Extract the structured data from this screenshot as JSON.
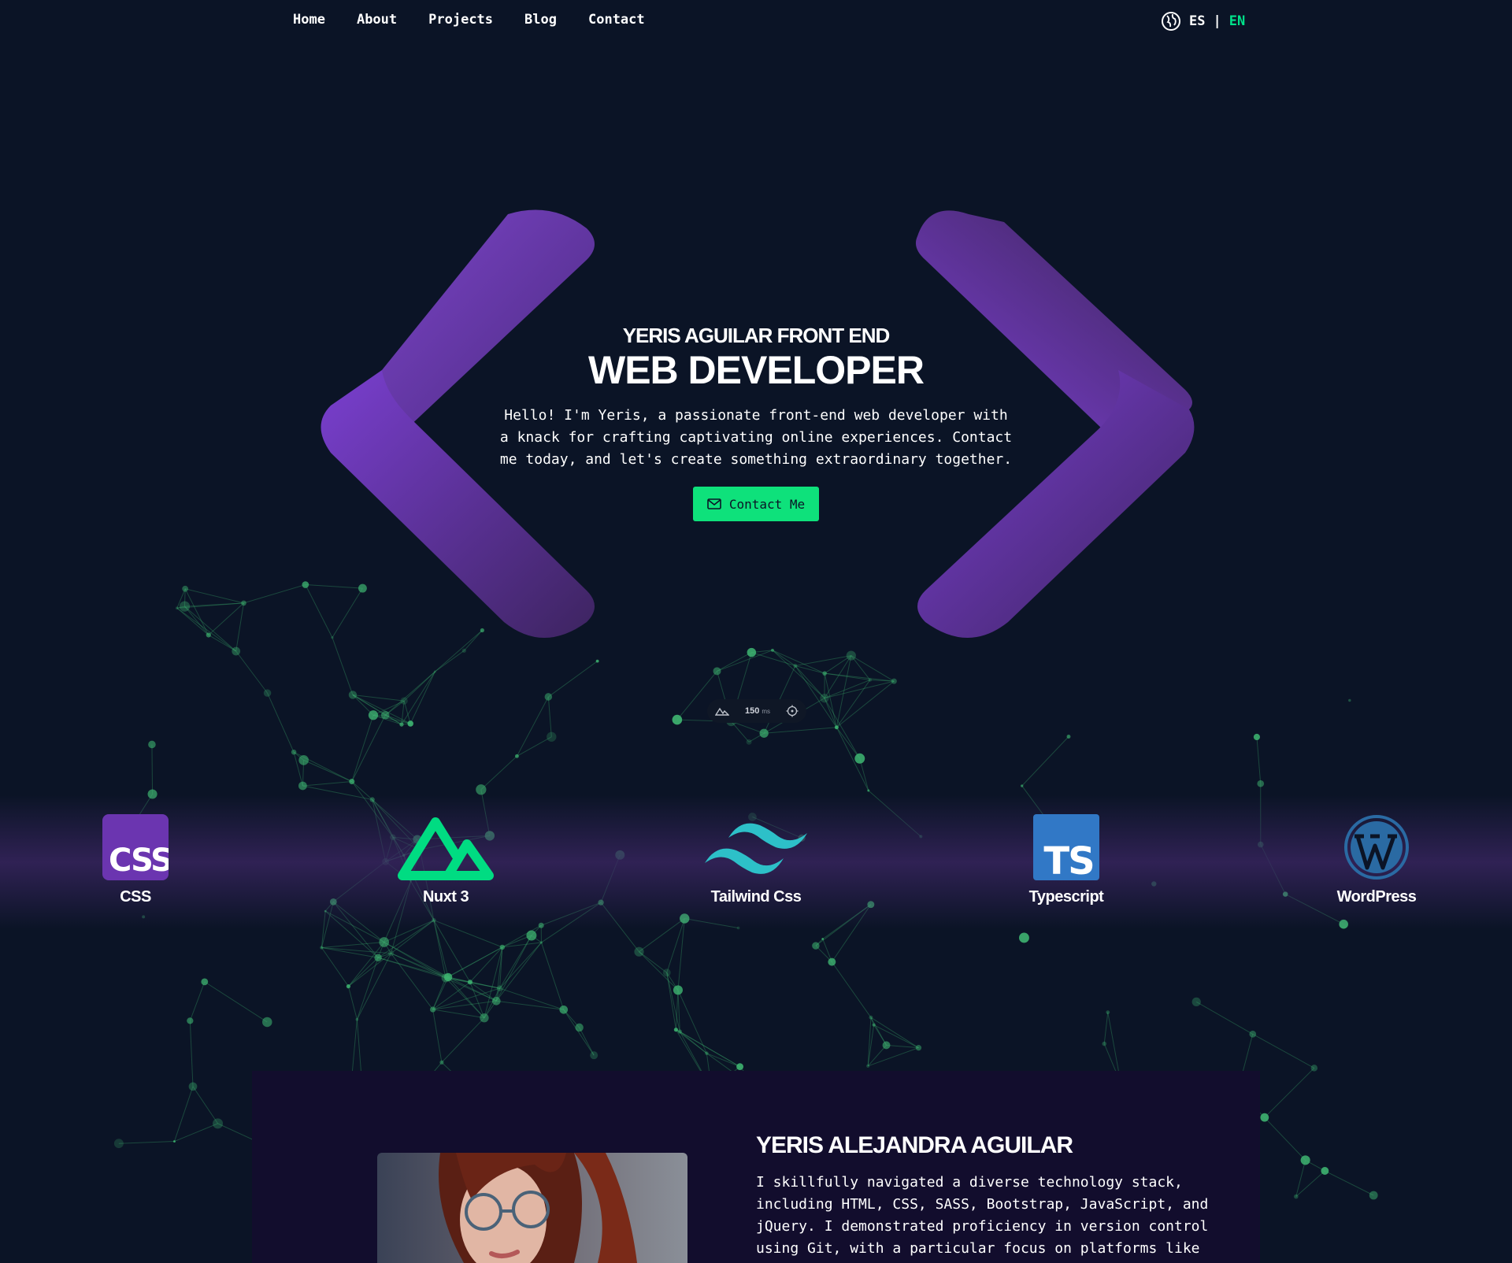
{
  "nav": {
    "links": [
      "Home",
      "About",
      "Projects",
      "Blog",
      "Contact"
    ],
    "lang_es": "ES",
    "lang_sep": "|",
    "lang_en": "EN"
  },
  "hero": {
    "subtitle": "YERIS AGUILAR FRONT END",
    "title": "WEB DEVELOPER",
    "description": "Hello! I'm Yeris, a passionate front-end web developer with a knack for crafting captivating online experiences. Contact me today, and let's create something extraordinary together.",
    "cta_label": "Contact Me"
  },
  "perf_pill": {
    "value": "150",
    "unit": "ms"
  },
  "technologies": [
    {
      "label": "CSS",
      "icon": "css-icon"
    },
    {
      "label": "Nuxt 3",
      "icon": "nuxt-icon"
    },
    {
      "label": "Tailwind Css",
      "icon": "tailwind-icon"
    },
    {
      "label": "Typescript",
      "icon": "typescript-icon"
    },
    {
      "label": "WordPress",
      "icon": "wordpress-icon"
    }
  ],
  "about": {
    "name": "YERIS ALEJANDRA AGUILAR",
    "bio": "I skillfully navigated a diverse technology stack, including HTML, CSS, SASS, Bootstrap, JavaScript, and jQuery. I demonstrated proficiency in version control using Git, with a particular focus on platforms like"
  },
  "colors": {
    "background": "#0b1426",
    "accent": "#0ee17b",
    "purple": "#7b3fc4",
    "about_bg": "#120d2d"
  }
}
